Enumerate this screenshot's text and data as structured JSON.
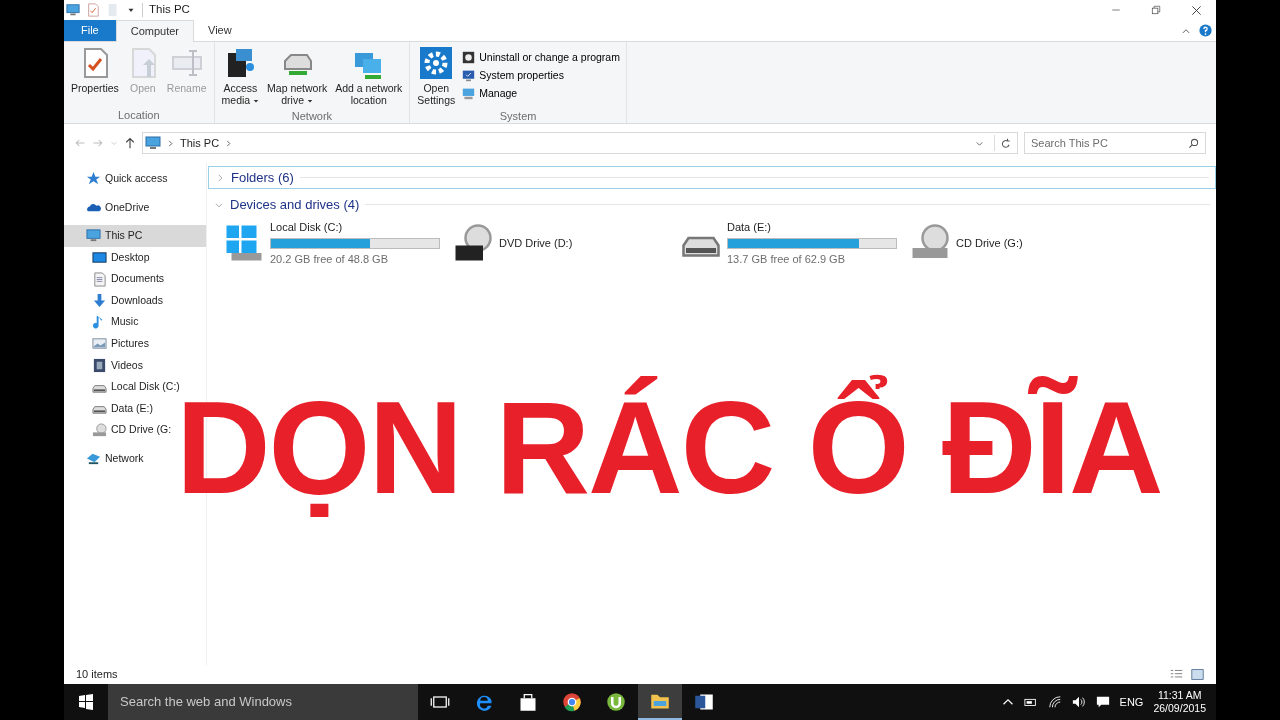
{
  "window": {
    "title": "This PC"
  },
  "ribbon_tabs": [
    {
      "label": "File",
      "kind": "file",
      "selected": false
    },
    {
      "label": "Computer",
      "kind": "tab",
      "selected": true
    },
    {
      "label": "View",
      "kind": "tab",
      "selected": false
    }
  ],
  "ribbon_groups": [
    {
      "label": "Location",
      "buttons": [
        {
          "lines": [
            "Properties"
          ],
          "kind": "properties",
          "disabled": false,
          "dropdown": false
        },
        {
          "lines": [
            "Open"
          ],
          "kind": "open",
          "disabled": true,
          "dropdown": false
        },
        {
          "lines": [
            "Rename"
          ],
          "kind": "rename",
          "disabled": true,
          "dropdown": false
        }
      ]
    },
    {
      "label": "Network",
      "buttons": [
        {
          "lines": [
            "Access",
            "media"
          ],
          "kind": "media",
          "disabled": false,
          "dropdown": true
        },
        {
          "lines": [
            "Map network",
            "drive"
          ],
          "kind": "netdrive",
          "disabled": false,
          "dropdown": true
        },
        {
          "lines": [
            "Add a network",
            "location"
          ],
          "kind": "netloc",
          "disabled": false,
          "dropdown": false
        }
      ]
    },
    {
      "label": "System",
      "buttons": [
        {
          "lines": [
            "Open",
            "Settings"
          ],
          "kind": "settings",
          "disabled": false,
          "dropdown": false
        }
      ],
      "small_buttons": [
        {
          "label": "Uninstall or change a program",
          "kind": "uninstall"
        },
        {
          "label": "System properties",
          "kind": "sysprops"
        },
        {
          "label": "Manage",
          "kind": "manage"
        }
      ]
    }
  ],
  "address": {
    "path": [
      "This PC"
    ],
    "search_placeholder": "Search This PC"
  },
  "sidebar": {
    "items": [
      {
        "label": "Quick access",
        "kind": "star",
        "selected": false
      },
      {
        "label": "OneDrive",
        "kind": "cloud",
        "selected": false
      },
      {
        "label": "This PC",
        "kind": "pc",
        "selected": true,
        "children": [
          {
            "label": "Desktop",
            "kind": "desktop",
            "selected": false
          },
          {
            "label": "Documents",
            "kind": "documents",
            "selected": false
          },
          {
            "label": "Downloads",
            "kind": "downloads",
            "selected": false
          },
          {
            "label": "Music",
            "kind": "music",
            "selected": false
          },
          {
            "label": "Pictures",
            "kind": "pictures",
            "selected": false
          },
          {
            "label": "Videos",
            "kind": "videos",
            "selected": false
          },
          {
            "label": "Local Disk (C:)",
            "kind": "disk",
            "selected": false
          },
          {
            "label": "Data (E:)",
            "kind": "disk",
            "selected": false
          },
          {
            "label": "CD Drive (G:",
            "kind": "cd",
            "selected": false
          }
        ]
      },
      {
        "label": "Network",
        "kind": "network",
        "selected": false
      }
    ]
  },
  "sections": [
    {
      "label": "Folders (6)",
      "expanded": false,
      "selected": true
    },
    {
      "label": "Devices and drives (4)",
      "expanded": true,
      "selected": false
    }
  ],
  "drives": [
    {
      "name": "Local Disk (C:)",
      "kind": "windisk",
      "level": 0.59,
      "reading": "20.2 GB free of 48.8 GB"
    },
    {
      "name": "DVD Drive (D:)",
      "kind": "dvd"
    },
    {
      "name": "Data (E:)",
      "kind": "disk",
      "level": 0.78,
      "reading": "13.7 GB free of 62.9 GB"
    },
    {
      "name": "CD Drive (G:)",
      "kind": "cd"
    }
  ],
  "status_bar": {
    "count": "10 items"
  },
  "taskbar": {
    "search_placeholder": "Search the web and Windows",
    "apps": [
      {
        "kind": "taskview",
        "selected": false
      },
      {
        "kind": "edge",
        "selected": false
      },
      {
        "kind": "store",
        "selected": false
      },
      {
        "kind": "chrome",
        "selected": false
      },
      {
        "kind": "torrent",
        "selected": false
      },
      {
        "kind": "explorer",
        "selected": true
      },
      {
        "kind": "word",
        "selected": false
      }
    ],
    "language": "ENG",
    "time": "11:31 AM",
    "date": "26/09/2015"
  },
  "overlay": {
    "text": "DỌN RÁC Ổ ĐĨA"
  }
}
